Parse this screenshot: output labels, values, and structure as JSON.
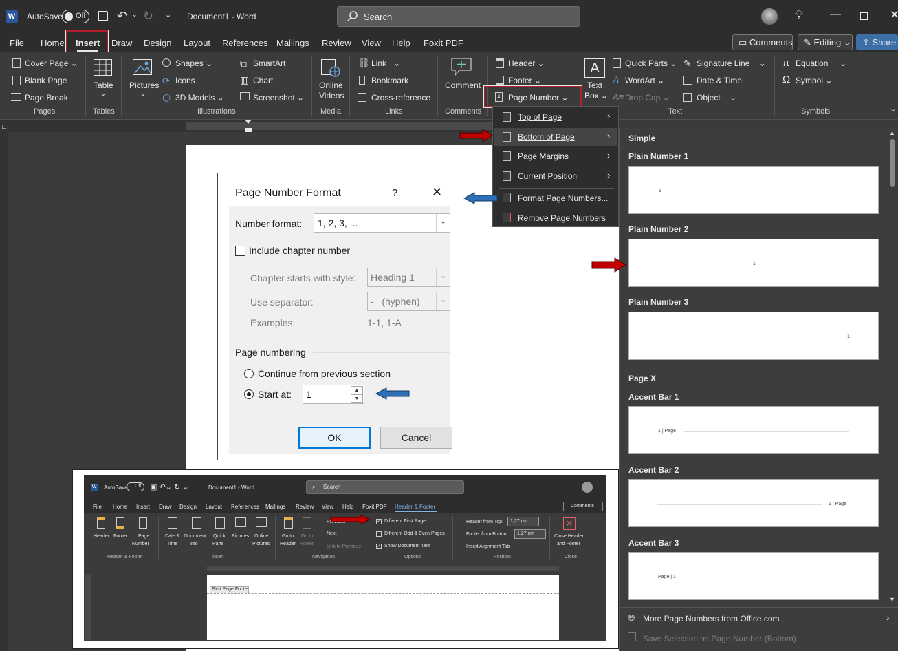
{
  "titlebar": {
    "autosave_label": "AutoSave",
    "autosave_state": "Off",
    "document_title": "Document1  -  Word",
    "search_placeholder": "Search"
  },
  "tabs": [
    "File",
    "Home",
    "Insert",
    "Draw",
    "Design",
    "Layout",
    "References",
    "Mailings",
    "Review",
    "View",
    "Help",
    "Foxit PDF"
  ],
  "active_tab": "Insert",
  "top_right": {
    "comments": "Comments",
    "editing": "Editing",
    "share": "Share"
  },
  "ribbon": {
    "pages": {
      "items": [
        "Cover Page",
        "Blank Page",
        "Page Break"
      ],
      "label": "Pages"
    },
    "tables": {
      "table": "Table",
      "label": "Tables"
    },
    "illustrations": {
      "pictures": "Pictures",
      "shapes": "Shapes",
      "icons": "Icons",
      "models": "3D Models",
      "smartart": "SmartArt",
      "chart": "Chart",
      "screenshot": "Screenshot",
      "label": "Illustrations"
    },
    "media": {
      "online": "Online",
      "videos": "Videos",
      "label": "Media"
    },
    "links": {
      "link": "Link",
      "bookmark": "Bookmark",
      "crossref": "Cross-reference",
      "label": "Links"
    },
    "comments": {
      "comment": "Comment",
      "label": "Comments"
    },
    "header_footer": {
      "header": "Header",
      "footer": "Footer",
      "page_number": "Page Number"
    },
    "text": {
      "textbox1": "Text",
      "textbox2": "Box",
      "quickparts": "Quick Parts",
      "wordart": "WordArt",
      "dropcap": "Drop Cap",
      "signature": "Signature Line",
      "datetime": "Date & Time",
      "object": "Object",
      "label": "Text"
    },
    "symbols": {
      "equation": "Equation",
      "symbol": "Symbol",
      "label": "Symbols"
    }
  },
  "page_number_menu": [
    "Top of Page",
    "Bottom of Page",
    "Page Margins",
    "Current Position",
    "Format Page Numbers...",
    "Remove Page Numbers"
  ],
  "gallery": {
    "section_simple": "Simple",
    "section_pagex": "Page X",
    "items": [
      {
        "title": "Plain Number 1",
        "preview": "1"
      },
      {
        "title": "Plain Number 2",
        "preview": "1"
      },
      {
        "title": "Plain Number 3",
        "preview": "1"
      },
      {
        "title": "Accent Bar 1",
        "preview": "1 | Page"
      },
      {
        "title": "Accent Bar 2",
        "preview": "1 | Page"
      },
      {
        "title": "Accent Bar 3",
        "preview": "Page | 1"
      }
    ],
    "more": "More Page Numbers from Office.com",
    "save_selection": "Save Selection as Page Number (Bottom)"
  },
  "dialog": {
    "title": "Page Number Format",
    "help": "?",
    "number_format_label": "Number format:",
    "number_format_value": "1, 2, 3, ...",
    "include_chapter": "Include chapter number",
    "chapter_style_label": "Chapter starts with style:",
    "chapter_style_value": "Heading 1",
    "separator_label": "Use separator:",
    "separator_value": "-   (hyphen)",
    "examples_label": "Examples:",
    "examples_value": "1-1, 1-A",
    "page_numbering": "Page numbering",
    "continue": "Continue from previous section",
    "start_at": "Start at:",
    "start_value": "1",
    "ok": "OK",
    "cancel": "Cancel"
  },
  "inset": {
    "autosave_label": "AutoSave",
    "autosave_state": "Off",
    "document_title": "Document1  -  Word",
    "search": "Search",
    "tabs": [
      "File",
      "Home",
      "Insert",
      "Draw",
      "Design",
      "Layout",
      "References",
      "Mailings",
      "Review",
      "View",
      "Help",
      "Foxit PDF",
      "Header & Footer"
    ],
    "comments": "Comments",
    "hf_items": {
      "header": "Header",
      "footer": "Footer",
      "page": "Page",
      "number": "Number"
    },
    "insert_items": {
      "date": "Date &",
      "time": "Time",
      "document": "Document",
      "info": "Info",
      "quick": "Quick",
      "parts": "Parts",
      "pictures": "Pictures",
      "online": "Online",
      "online2": "Pictures"
    },
    "nav_items": {
      "goto_header1": "Go to",
      "goto_header2": "Header",
      "goto_footer1": "Go to",
      "goto_footer2": "Footer",
      "previous": "Previous",
      "next": "Next",
      "link": "Link to Previous"
    },
    "options": {
      "diff_first": "Different First Page",
      "diff_odd": "Different Odd & Even Pages",
      "show_doc": "Show Document Text"
    },
    "position": {
      "header_top": "Header from Top:",
      "header_top_val": "1,27 cm",
      "footer_bottom": "Footer from Bottom:",
      "footer_bottom_val": "1,27 cm",
      "align_tab": "Insert Alignment Tab"
    },
    "close": {
      "close1": "Close Header",
      "close2": "and Footer"
    },
    "group_labels": {
      "hf": "Header & Footer",
      "insert": "Insert",
      "nav": "Navigation",
      "options": "Options",
      "position": "Position",
      "close": "Close"
    },
    "footer_tag": "First Page Footer"
  },
  "colors": {
    "accent_red": "#b81d2b",
    "arrow_blue": "#2e6fb5",
    "arrow_red": "#c00000"
  }
}
